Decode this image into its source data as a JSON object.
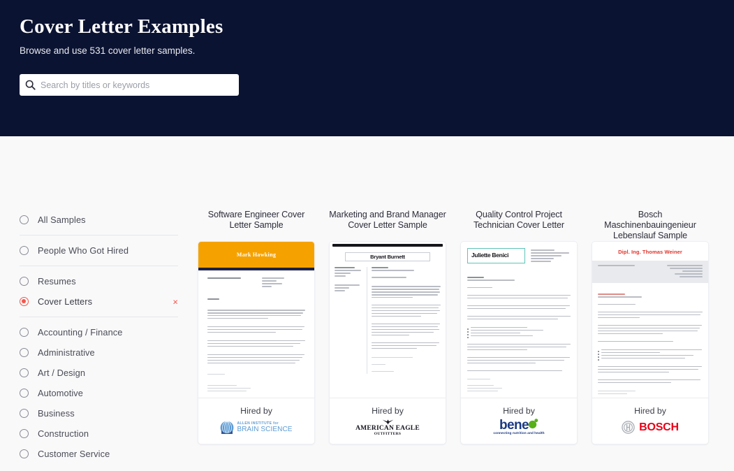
{
  "hero": {
    "title": "Cover Letter Examples",
    "subtitle": "Browse and use 531 cover letter samples.",
    "search": {
      "placeholder": "Search by titles or keywords",
      "value": "",
      "icon": "search-icon"
    },
    "background_color": "#0b1332"
  },
  "sidebar": {
    "accent_color": "#f4564b",
    "clear_icon": "×",
    "groups": [
      {
        "items": [
          {
            "label": "All Samples",
            "selected": false
          }
        ]
      },
      {
        "items": [
          {
            "label": "People Who Got Hired",
            "selected": false
          }
        ]
      },
      {
        "items": [
          {
            "label": "Resumes",
            "selected": false
          },
          {
            "label": "Cover Letters",
            "selected": true,
            "clearable": true
          }
        ]
      },
      {
        "items": [
          {
            "label": "Accounting / Finance",
            "selected": false
          },
          {
            "label": "Administrative",
            "selected": false
          },
          {
            "label": "Art / Design",
            "selected": false
          },
          {
            "label": "Automotive",
            "selected": false
          },
          {
            "label": "Business",
            "selected": false
          },
          {
            "label": "Construction",
            "selected": false
          },
          {
            "label": "Customer Service",
            "selected": false
          }
        ]
      }
    ]
  },
  "cards": [
    {
      "title": "Software Engineer Cover Letter Sample",
      "hired_label": "Hired by",
      "company": "Allen Institute for Brain Science",
      "logo_line_1": "ALLEN INSTITUTE for",
      "logo_line_2": "BRAIN SCIENCE",
      "doc_name": "Mark Hawking",
      "accent_color": "#f5a200"
    },
    {
      "title": "Marketing and Brand Manager Cover Letter Sample",
      "hired_label": "Hired by",
      "company": "American Eagle Outfitters",
      "logo_line_1": "AMERICAN EAGLE",
      "logo_line_2": "OUTFITTERS",
      "doc_name": "Bryant Burnett",
      "accent_color": "#15151c"
    },
    {
      "title": "Quality Control Project Technician Cover Letter",
      "hired_label": "Hired by",
      "company": "beneo",
      "logo_line_1": "bene",
      "logo_line_2": "connecting nutrition and health",
      "doc_name": "Juliette Benici",
      "accent_color": "#5ec4b8"
    },
    {
      "title": "Bosch Maschinenbauingenieur Lebenslauf Sample",
      "hired_label": "Hired by",
      "company": "BOSCH",
      "logo_line_1": "BOSCH",
      "logo_line_2": "",
      "doc_name": "Dipl. Ing. Thomas Weiner",
      "accent_color": "#ea0016"
    }
  ]
}
